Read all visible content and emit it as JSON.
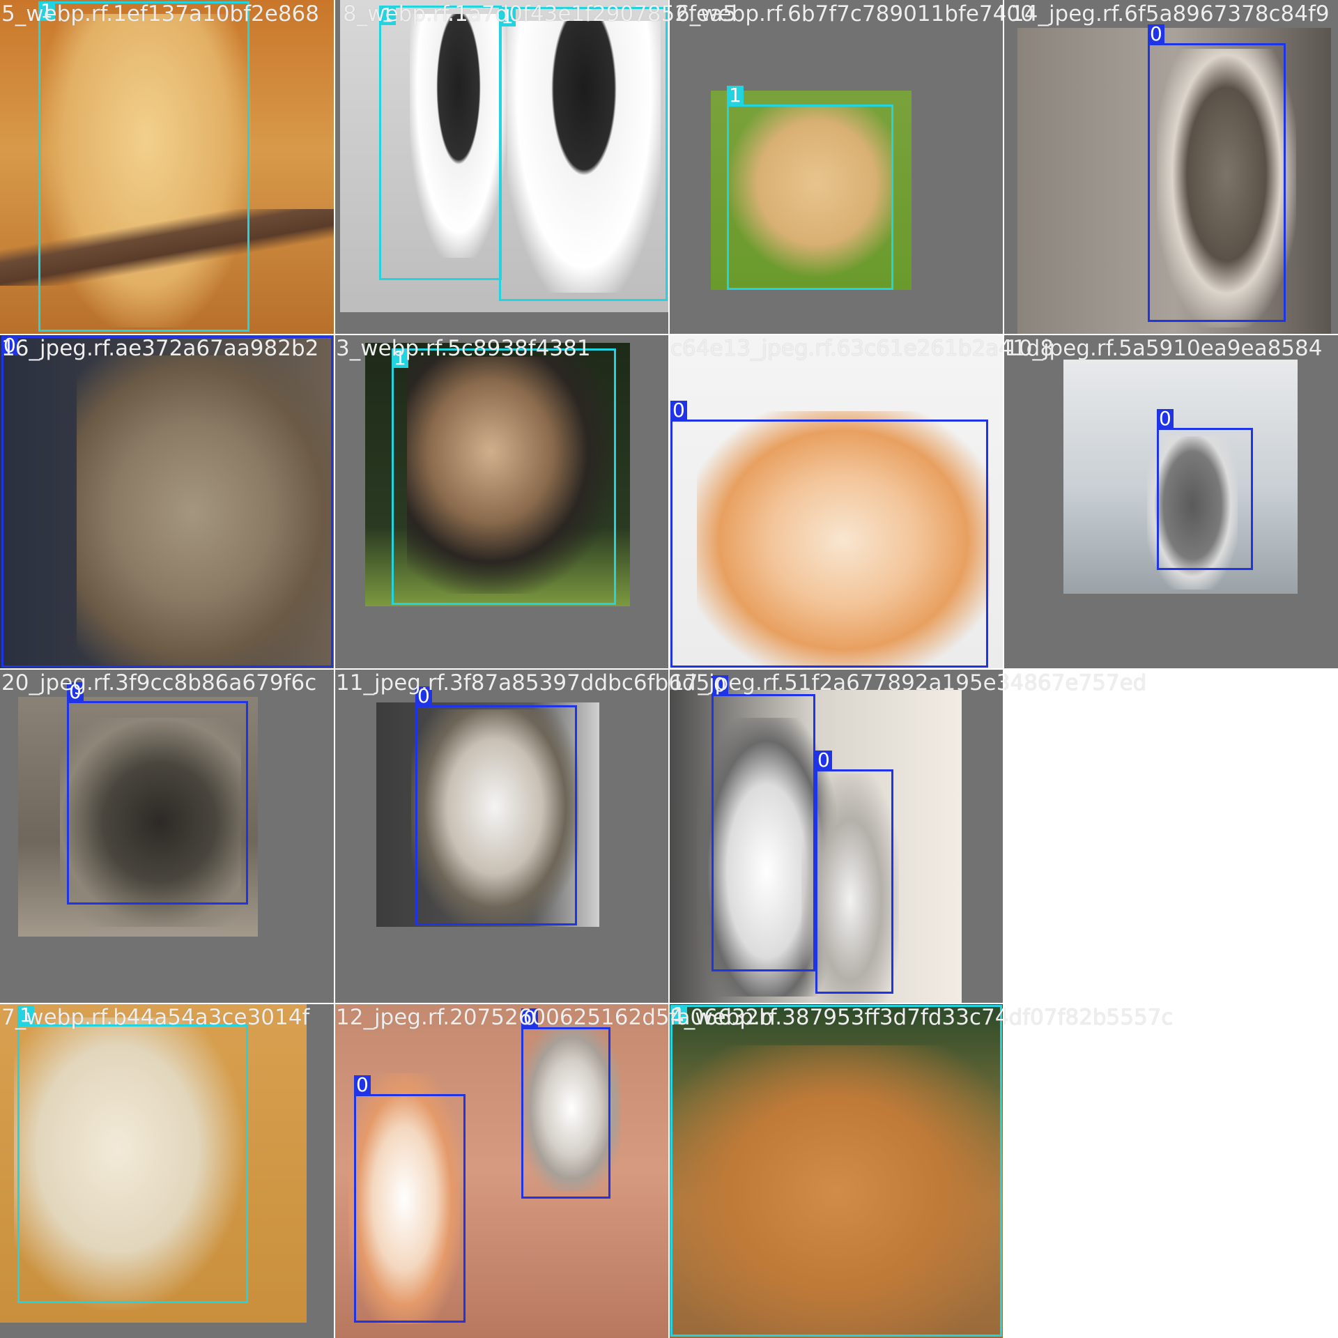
{
  "mosaic": {
    "colors": {
      "cat_box": "#1e34e6",
      "dog_box": "#22d3e0",
      "padding_gray": "#727272",
      "label_text": "#eeeeee"
    },
    "legend": {
      "0": "class-0-box",
      "1": "class-1-box"
    },
    "tiles": [
      {
        "filename": "5_webp.rf.1ef137a10bf2e868",
        "subject": "golden-retriever",
        "boxes": [
          {
            "cls": "1"
          }
        ]
      },
      {
        "filename": "8_webp.rf.1a7d0f43e1f2907852fea5",
        "subject": "french-bulldog-puppies",
        "boxes": [
          {
            "cls": "1"
          },
          {
            "cls": "1"
          }
        ]
      },
      {
        "filename": "6_webp.rf.6b7f7c789011bfe7400",
        "subject": "labrador",
        "boxes": [
          {
            "cls": "1"
          }
        ]
      },
      {
        "filename": "14_jpeg.rf.6f5a8967378c84f9",
        "subject": "tabby-kitten",
        "boxes": [
          {
            "cls": "0"
          }
        ]
      },
      {
        "filename": "16_jpeg.rf.ae372a67aa982b2",
        "subject": "long-haired-cat",
        "boxes": [
          {
            "cls": "0"
          }
        ]
      },
      {
        "filename": "3_webp.rf.5c8938f4381",
        "subject": "german-shepherd",
        "boxes": [
          {
            "cls": "1"
          }
        ]
      },
      {
        "filename": "c64e13_jpeg.rf.63c61e261b2a41d8",
        "subject": "orange-cat",
        "boxes": [
          {
            "cls": "0"
          }
        ]
      },
      {
        "filename": "10_jpeg.rf.5a5910ea9ea8584",
        "subject": "gray-tabby-cat",
        "boxes": [
          {
            "cls": "0"
          }
        ]
      },
      {
        "filename": "20_jpeg.rf.3f9cc8b86a679f6c",
        "subject": "curled-tabby-cat",
        "boxes": [
          {
            "cls": "0"
          }
        ]
      },
      {
        "filename": "11_jpeg.rf.3f87a85397ddbc6fb6d5",
        "subject": "white-tabby-cat",
        "boxes": [
          {
            "cls": "0"
          }
        ]
      },
      {
        "filename": "17_jpeg.rf.51f2a677892a195e34867e757ed",
        "subject": "two-cats",
        "boxes": [
          {
            "cls": "0"
          },
          {
            "cls": "0"
          }
        ]
      },
      {
        "filename": "",
        "subject": "empty",
        "boxes": []
      },
      {
        "filename": "7_webp.rf.b44a54a3ce3014f",
        "subject": "white-french-bulldog",
        "boxes": [
          {
            "cls": "1"
          }
        ]
      },
      {
        "filename": "12_jpeg.rf.20752600625162d5fa06632b",
        "subject": "fluffy-kittens",
        "boxes": [
          {
            "cls": "0"
          },
          {
            "cls": "0"
          }
        ]
      },
      {
        "filename": "4_webp.rf.387953ff3d7fd33c74df07f82b5557c",
        "subject": "golden-dog-closeup",
        "boxes": [
          {
            "cls": "1"
          }
        ]
      },
      {
        "filename": "",
        "subject": "empty",
        "boxes": []
      }
    ]
  }
}
